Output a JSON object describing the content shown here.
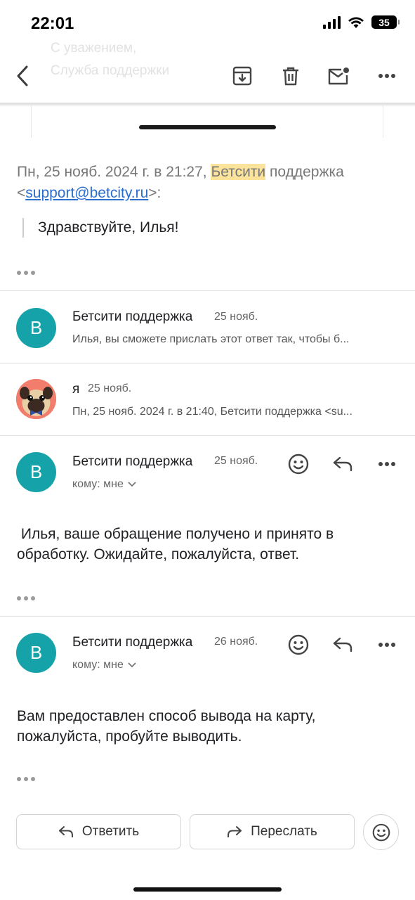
{
  "status_bar": {
    "time": "22:01",
    "battery": "35"
  },
  "background_text": {
    "line1": "С уважением,",
    "line2": "Служба поддержки"
  },
  "toolbar": {
    "back_icon": "chevron-left-icon",
    "archive_icon": "archive-icon",
    "delete_icon": "trash-icon",
    "mark_unread_icon": "mail-unread-icon",
    "more_icon": "more-horizontal-icon"
  },
  "quoted": {
    "header_prefix": "Пн, 25 нояб. 2024 г. в 21:27, ",
    "highlight": "Бетсити",
    "header_middle": " поддержка",
    "lt": "<",
    "email": "support@betcity.ru",
    "gt": ">:",
    "body": "Здравствуйте, Илья!"
  },
  "messages": [
    {
      "avatar_letter": "B",
      "sender": "Бетсити поддержка",
      "date": "25 нояб.",
      "snippet": "Илья, вы сможете прислать этот ответ так, чтобы б..."
    },
    {
      "sender": "я",
      "date": "25 нояб.",
      "snippet": "Пн, 25 нояб. 2024 г. в 21:40, Бетсити поддержка <su..."
    },
    {
      "avatar_letter": "B",
      "sender": "Бетсити поддержка",
      "date": "25 нояб.",
      "to": "кому: мне",
      "body": " Илья, ваше обращение получено и принято в обработку. Ожидайте, пожалуйста, ответ."
    },
    {
      "avatar_letter": "B",
      "sender": "Бетсити поддержка",
      "date": "26 нояб.",
      "to": "кому: мне",
      "body": "Вам предоставлен способ вывода на карту, пожалуйста, пробуйте выводить."
    }
  ],
  "actions": {
    "reply": "Ответить",
    "forward": "Переслать"
  },
  "colors": {
    "avatar": "#16a2a9",
    "highlight": "#fbe39b",
    "link": "#2a6fd0"
  }
}
